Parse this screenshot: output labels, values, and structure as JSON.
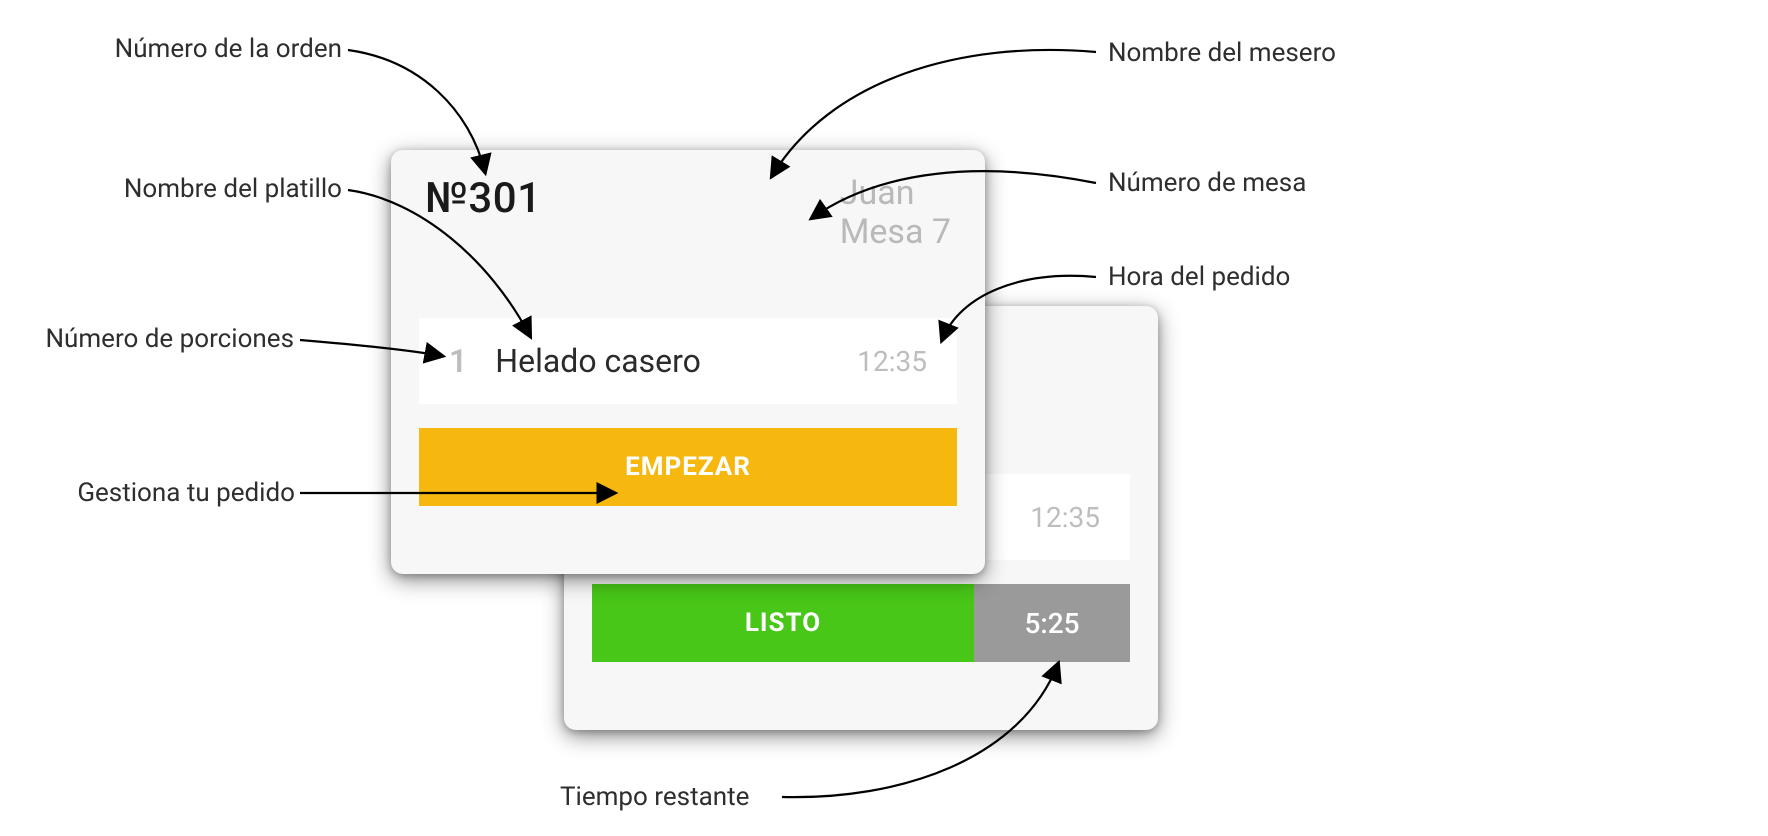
{
  "labels": {
    "order_number": "Número de la orden",
    "dish_name": "Nombre del platillo",
    "portions": "Número de porciones",
    "manage_order": "Gestiona tu pedido",
    "waiter_name": "Nombre del mesero",
    "table_number": "Número de mesa",
    "order_time": "Hora del pedido",
    "time_remaining": "Tiempo restante"
  },
  "cardA": {
    "order_number": "№301",
    "waiter": "Juan",
    "table": "Mesa 7",
    "qty": "1",
    "dish": "Helado casero",
    "time": "12:35",
    "button": "EMPEZAR"
  },
  "cardB": {
    "time": "12:35",
    "button": "LISTO",
    "countdown": "5:25"
  },
  "colors": {
    "start_button": "#f6b80f",
    "ready_button": "#48c718",
    "timer_box": "#9a9a9a",
    "card_bg": "#f7f7f7",
    "muted_text": "#b9b9b9"
  }
}
